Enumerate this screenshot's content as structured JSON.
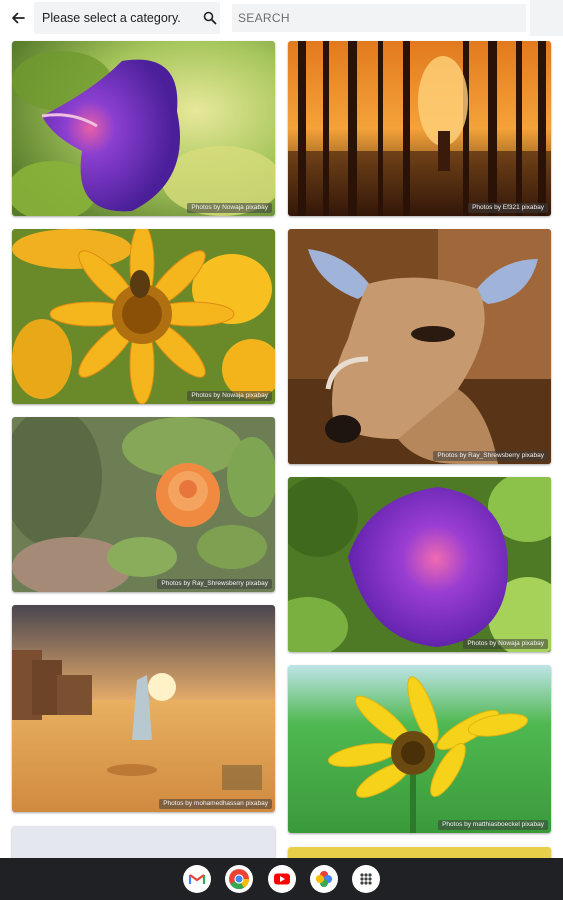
{
  "header": {
    "category_label": "Please select a category.",
    "search_placeholder": "SEARCH"
  },
  "photos": [
    {
      "subject": "purple morning glory",
      "credit": "Photos by Nowaja   pixabay"
    },
    {
      "subject": "forest at sunset with reflection",
      "credit": "Photos by Ef321   pixabay"
    },
    {
      "subject": "yellow daisy with bee",
      "credit": "Photos by Nowaja   pixabay"
    },
    {
      "subject": "deer portrait",
      "credit": "Photos by Ray_Shrewsberry   pixabay"
    },
    {
      "subject": "orange rose",
      "credit": "Photos by Ray_Shrewsberry   pixabay"
    },
    {
      "subject": "purple morning glory",
      "credit": "Photos by Nowaja   pixabay"
    },
    {
      "subject": "desert walker at sunset",
      "credit": "Photos by mohamedhassan   pixabay"
    },
    {
      "subject": "sunflower",
      "credit": "Photos by matthiasboeckel   pixabay"
    }
  ],
  "taskbar": {
    "apps": [
      "Gmail",
      "Chrome",
      "YouTube",
      "Photos",
      "App launcher"
    ]
  },
  "colors": {
    "taskbar_bg": "#202124",
    "search_bg": "#f1f3f4"
  }
}
